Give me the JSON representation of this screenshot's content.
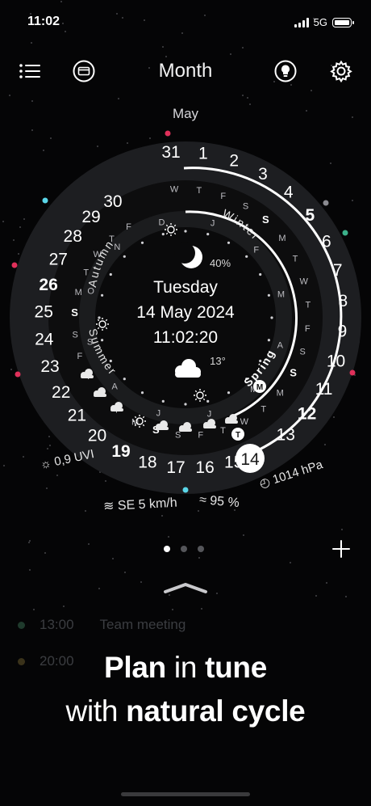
{
  "status": {
    "time": "11:02",
    "network": "5G"
  },
  "toolbar": {
    "title": "Month"
  },
  "dial": {
    "month_label": "May",
    "day_of_week": "Tuesday",
    "date": "14 May 2024",
    "time": "11:02:20",
    "moon_illumination": "40%",
    "temperature": "13°",
    "seasons": [
      "Winter",
      "Spring",
      "Summer",
      "Autumn"
    ],
    "days": [
      "31",
      "1",
      "2",
      "3",
      "4",
      "5",
      "6",
      "7",
      "8",
      "9",
      "10",
      "11",
      "12",
      "13",
      "14",
      "15",
      "16",
      "17",
      "18",
      "19",
      "20",
      "21",
      "22",
      "23",
      "24",
      "25",
      "26",
      "27",
      "28",
      "29",
      "30"
    ],
    "today": "14",
    "weekday_letters": [
      "W",
      "T",
      "F",
      "S",
      "S",
      "M",
      "T",
      "W",
      "T",
      "F",
      "S",
      "S",
      "M",
      "T",
      "W",
      "T",
      "F",
      "S",
      "S",
      "M",
      "T",
      "W",
      "T",
      "F",
      "S",
      "S",
      "M",
      "T",
      "W",
      "T",
      "F"
    ],
    "month_letters": [
      "D",
      "J",
      "F",
      "M",
      "A",
      "M",
      "J",
      "J",
      "A",
      "S",
      "O",
      "N"
    ],
    "bottom_markers": [
      "T",
      "M"
    ]
  },
  "weather": {
    "uv": "0,9 UVI",
    "wind": "SE 5 km/h",
    "humidity": "95 %",
    "pressure": "1014 hPa"
  },
  "pager": {
    "pages": 3,
    "active": 0
  },
  "ghost_events": [
    {
      "time": "13:00",
      "title": "Team meeting"
    },
    {
      "time": "20:00",
      "title": ""
    }
  ],
  "tagline": {
    "line1_a": "Plan",
    "line1_b": "in",
    "line1_c": "tune",
    "line2_a": "with",
    "line2_b": "natural cycle"
  }
}
